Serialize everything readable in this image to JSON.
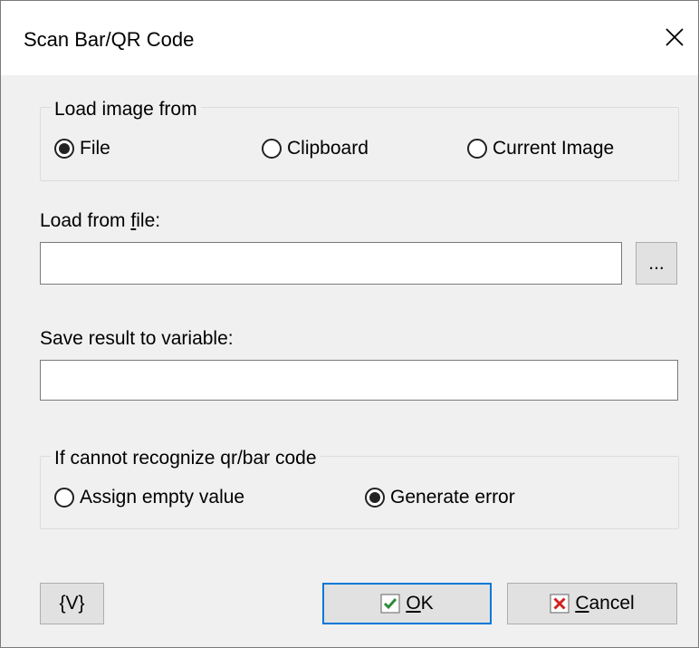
{
  "window": {
    "title": "Scan Bar/QR Code"
  },
  "load_group": {
    "legend": "Load image from",
    "options": [
      {
        "label": "File",
        "selected": true
      },
      {
        "label": "Clipboard",
        "selected": false
      },
      {
        "label": "Current Image",
        "selected": false
      }
    ]
  },
  "file": {
    "label_pre": "Load from ",
    "label_ul": "f",
    "label_post": "ile:",
    "value": "",
    "browse_label": "..."
  },
  "variable": {
    "label": "Save result to variable:",
    "value": ""
  },
  "error_group": {
    "legend": "If cannot recognize qr/bar code",
    "options": [
      {
        "label": "Assign empty value",
        "selected": false
      },
      {
        "label": "Generate error",
        "selected": true
      }
    ]
  },
  "buttons": {
    "variables": "{V}",
    "ok_ul": "O",
    "ok_rest": "K",
    "cancel_ul": "C",
    "cancel_rest": "ancel"
  },
  "colors": {
    "ok_check": "#2e8b3a",
    "cancel_x": "#d42020",
    "default_border": "#0078d7"
  }
}
